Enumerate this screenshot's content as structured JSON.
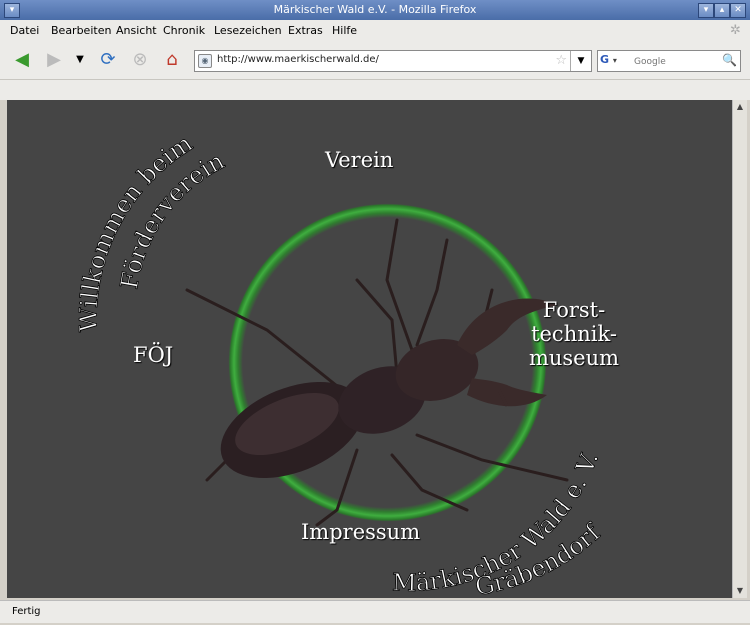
{
  "window": {
    "title": "Märkischer Wald e.V. - Mozilla Firefox",
    "buttons": {
      "menu": "▾",
      "minimize": "▾",
      "maximize": "▴",
      "close": "✕"
    }
  },
  "menubar": {
    "items": [
      {
        "label": "Datei"
      },
      {
        "label": "Bearbeiten"
      },
      {
        "label": "Ansicht"
      },
      {
        "label": "Chronik"
      },
      {
        "label": "Lesezeichen"
      },
      {
        "label": "Extras"
      },
      {
        "label": "Hilfe"
      }
    ]
  },
  "navbar": {
    "url": "http://www.maerkischerwald.de/",
    "search_placeholder": "Google",
    "search_engine": "G",
    "icons": {
      "back": "back-arrow-icon",
      "forward": "forward-arrow-icon",
      "history": "chevron-down-icon",
      "reload": "reload-icon",
      "stop": "stop-icon",
      "home": "home-icon"
    }
  },
  "page": {
    "links": {
      "verein": "Verein",
      "foej": "FÖJ",
      "forst1": "Forst-",
      "forst2": "technik-",
      "forst3": "museum",
      "impressum": "Impressum"
    },
    "arc_top_1": "Willkommen beim",
    "arc_top_2": "Förderverein",
    "arc_bottom_1": "Märkischer Wald e. V.",
    "arc_bottom_2": "Gräbendorf",
    "colors": {
      "background": "#454545",
      "ring": "#3fae3f",
      "text": "#ffffff"
    }
  },
  "status": {
    "text": "Fertig"
  }
}
